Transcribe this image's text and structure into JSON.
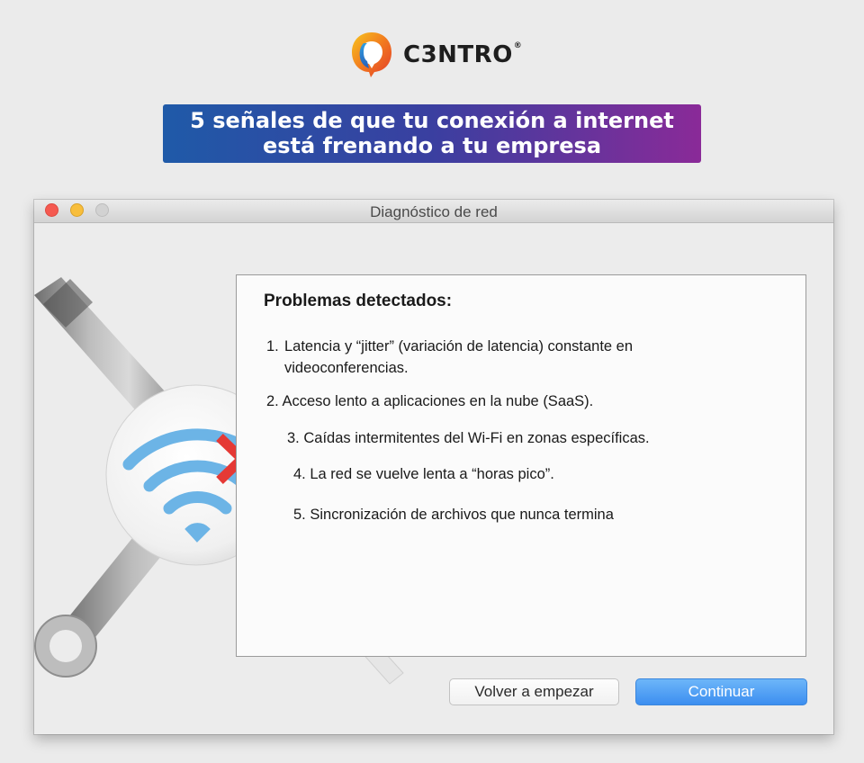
{
  "brand": {
    "name": "C3NTRO",
    "registered": "®"
  },
  "headline": {
    "line1": "5 señales de que tu conexión a internet",
    "line2": "está frenando a tu empresa"
  },
  "window": {
    "title": "Diagnóstico de red"
  },
  "panel": {
    "title": "Problemas detectados:",
    "items": [
      {
        "num": "1.",
        "text_line1": "Latencia y “jitter” (variación de latencia) constante en",
        "text_line2": "videoconferencias."
      },
      {
        "num": "2.",
        "text": "Acceso lento a aplicaciones en la nube (SaaS)."
      },
      {
        "num": "3.",
        "text": "Caídas intermitentes del Wi-Fi en zonas específicas."
      },
      {
        "num": "4.",
        "text": "La red se vuelve lenta a “horas pico”."
      },
      {
        "num": "5.",
        "text": "Sincronización de archivos que nunca termina"
      }
    ]
  },
  "buttons": {
    "restart": "Volver a empezar",
    "continue": "Continuar"
  },
  "icons": [
    "c3ntro-logo",
    "wrench-icon",
    "screwdriver-icon",
    "wifi-icon",
    "error-x-icon"
  ],
  "colors": {
    "headline_gradient_start": "#1f5aa8",
    "headline_gradient_end": "#8a2a98",
    "continue_button": "#3c8ef0",
    "wifi": "#6cb4e6",
    "error_x": "#e53935"
  }
}
